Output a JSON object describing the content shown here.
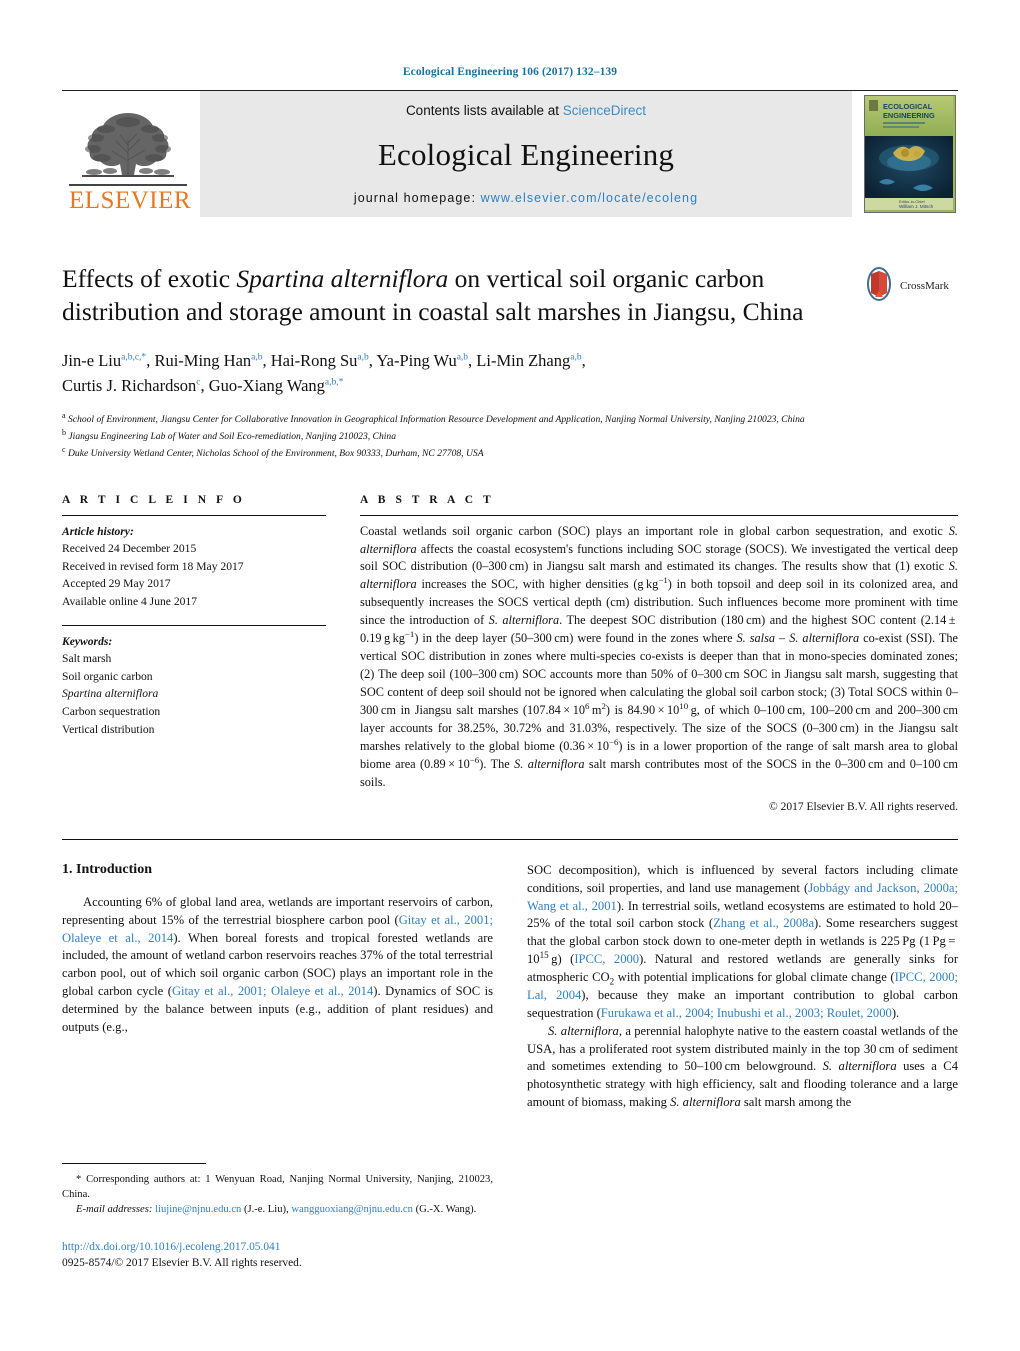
{
  "running_head": "Ecological Engineering 106 (2017) 132–139",
  "masthead": {
    "contents_prefix": "Contents lists available at ",
    "sciencedirect": "ScienceDirect",
    "journal_name": "Ecological Engineering",
    "homepage_prefix": "journal homepage: ",
    "homepage_url": "www.elsevier.com/locate/ecoleng",
    "publisher": "ELSEVIER",
    "cover_title_line1": "ECOLOGICAL",
    "cover_title_line2": "ENGINEERING",
    "accent_link_color": "#2f7fc1",
    "elsevier_orange": "#E87722"
  },
  "article": {
    "title_part1": "Effects of exotic ",
    "title_italic": "Spartina alterniflora",
    "title_part2": " on vertical soil organic carbon distribution and storage amount in coastal salt marshes in Jiangsu, China",
    "crossmark_label": "CrossMark"
  },
  "authors": [
    {
      "name": "Jin-e Liu",
      "marks": "a,b,c,*"
    },
    {
      "name": "Rui-Ming Han",
      "marks": "a,b"
    },
    {
      "name": "Hai-Rong Su",
      "marks": "a,b"
    },
    {
      "name": "Ya-Ping Wu",
      "marks": "a,b"
    },
    {
      "name": "Li-Min Zhang",
      "marks": "a,b"
    },
    {
      "name": "Curtis J. Richardson",
      "marks": "c"
    },
    {
      "name": "Guo-Xiang Wang",
      "marks": "a,b,*"
    }
  ],
  "affiliations": [
    {
      "mark": "a",
      "text": "School of Environment, Jiangsu Center for Collaborative Innovation in Geographical Information Resource Development and Application, Nanjing Normal University, Nanjing 210023, China"
    },
    {
      "mark": "b",
      "text": "Jiangsu Engineering Lab of Water and Soil Eco-remediation, Nanjing 210023, China"
    },
    {
      "mark": "c",
      "text": "Duke University Wetland Center, Nicholas School of the Environment, Box 90333, Durham, NC 27708, USA"
    }
  ],
  "article_info": {
    "heading": "A R T I C L E   I N F O",
    "history_label": "Article history:",
    "history": [
      "Received 24 December 2015",
      "Received in revised form 18 May 2017",
      "Accepted 29 May 2017",
      "Available online 4 June 2017"
    ],
    "keywords_label": "Keywords:",
    "keywords": [
      "Salt marsh",
      "Soil organic carbon",
      "Spartina alterniflora",
      "Carbon sequestration",
      "Vertical distribution"
    ],
    "keyword_italic_index": 2
  },
  "abstract": {
    "heading": "A B S T R A C T",
    "copyright": "© 2017 Elsevier B.V. All rights reserved."
  },
  "introduction": {
    "heading": "1.  Introduction"
  },
  "footnote": {
    "corresponding": "Corresponding authors at: 1 Wenyuan Road, Nanjing Normal University, Nanjing, 210023, China.",
    "email_label": "E-mail addresses:",
    "email1": "liujine@njnu.edu.cn",
    "email1_owner": "(J.-e. Liu)",
    "email2": "wangguoxiang@njnu.edu.cn",
    "email2_owner": "(G.-X. Wang)."
  },
  "doi": {
    "url": "http://dx.doi.org/10.1016/j.ecoleng.2017.05.041",
    "issn_line": "0925-8574/© 2017 Elsevier B.V. All rights reserved."
  }
}
